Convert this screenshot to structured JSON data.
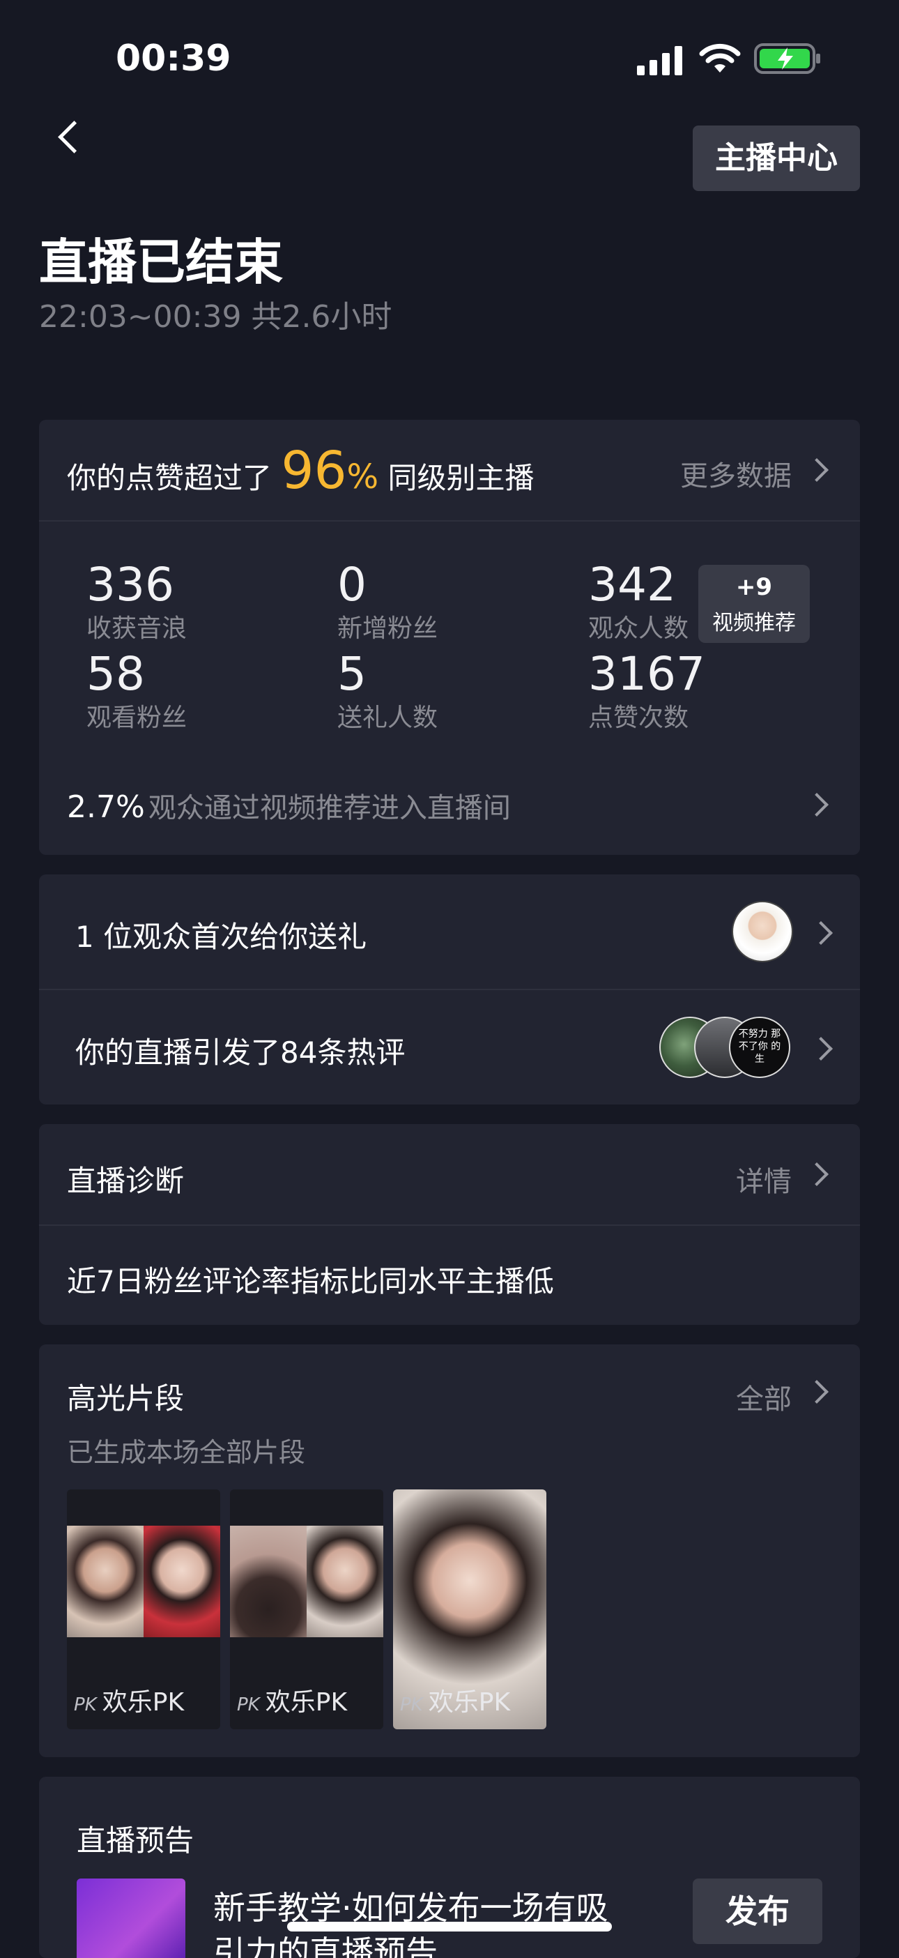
{
  "status_bar": {
    "time": "00:39"
  },
  "header": {
    "anchor_center_button": "主播中心"
  },
  "summary": {
    "title": "直播已结束",
    "time_range": "22:03~00:39 共2.6小时"
  },
  "likes_card": {
    "prefix": "你的点赞超过了",
    "percent": "96",
    "percent_sign": "%",
    "suffix": "同级别主播",
    "more_data": "更多数据",
    "stats": [
      {
        "value": "336",
        "label": "收获音浪"
      },
      {
        "value": "0",
        "label": "新增粉丝"
      },
      {
        "value": "342",
        "label": "观众人数"
      },
      {
        "value": "58",
        "label": "观看粉丝"
      },
      {
        "value": "5",
        "label": "送礼人数"
      },
      {
        "value": "3167",
        "label": "点赞次数"
      }
    ],
    "recommend_badge": {
      "count": "+9",
      "label": "视频推荐"
    },
    "footer_percent": "2.7%",
    "footer_text": "观众通过视频推荐进入直播间"
  },
  "gift_row": {
    "text": "1 位观众首次给你送礼"
  },
  "comments_row": {
    "text": "你的直播引发了84条热评",
    "avatar_caption": "不努力 那不了你 的生"
  },
  "diagnosis": {
    "title": "直播诊断",
    "detail": "详情",
    "message": "近7日粉丝评论率指标比同水平主播低"
  },
  "highlights": {
    "title": "高光片段",
    "all": "全部",
    "subtitle": "已生成本场全部片段",
    "clips": [
      {
        "pk_icon": "PK",
        "label": "欢乐PK"
      },
      {
        "pk_icon": "PK",
        "label": "欢乐PK"
      },
      {
        "pk_icon": "PK",
        "label": "欢乐PK"
      }
    ]
  },
  "preview": {
    "title": "直播预告",
    "tutorial_line1": "新手教学·如何发布一场有吸",
    "tutorial_line2": "引力的直播预告",
    "publish_button": "发布"
  },
  "colors": {
    "background": "#161823",
    "card": "#222431",
    "accent": "#f7b731"
  }
}
